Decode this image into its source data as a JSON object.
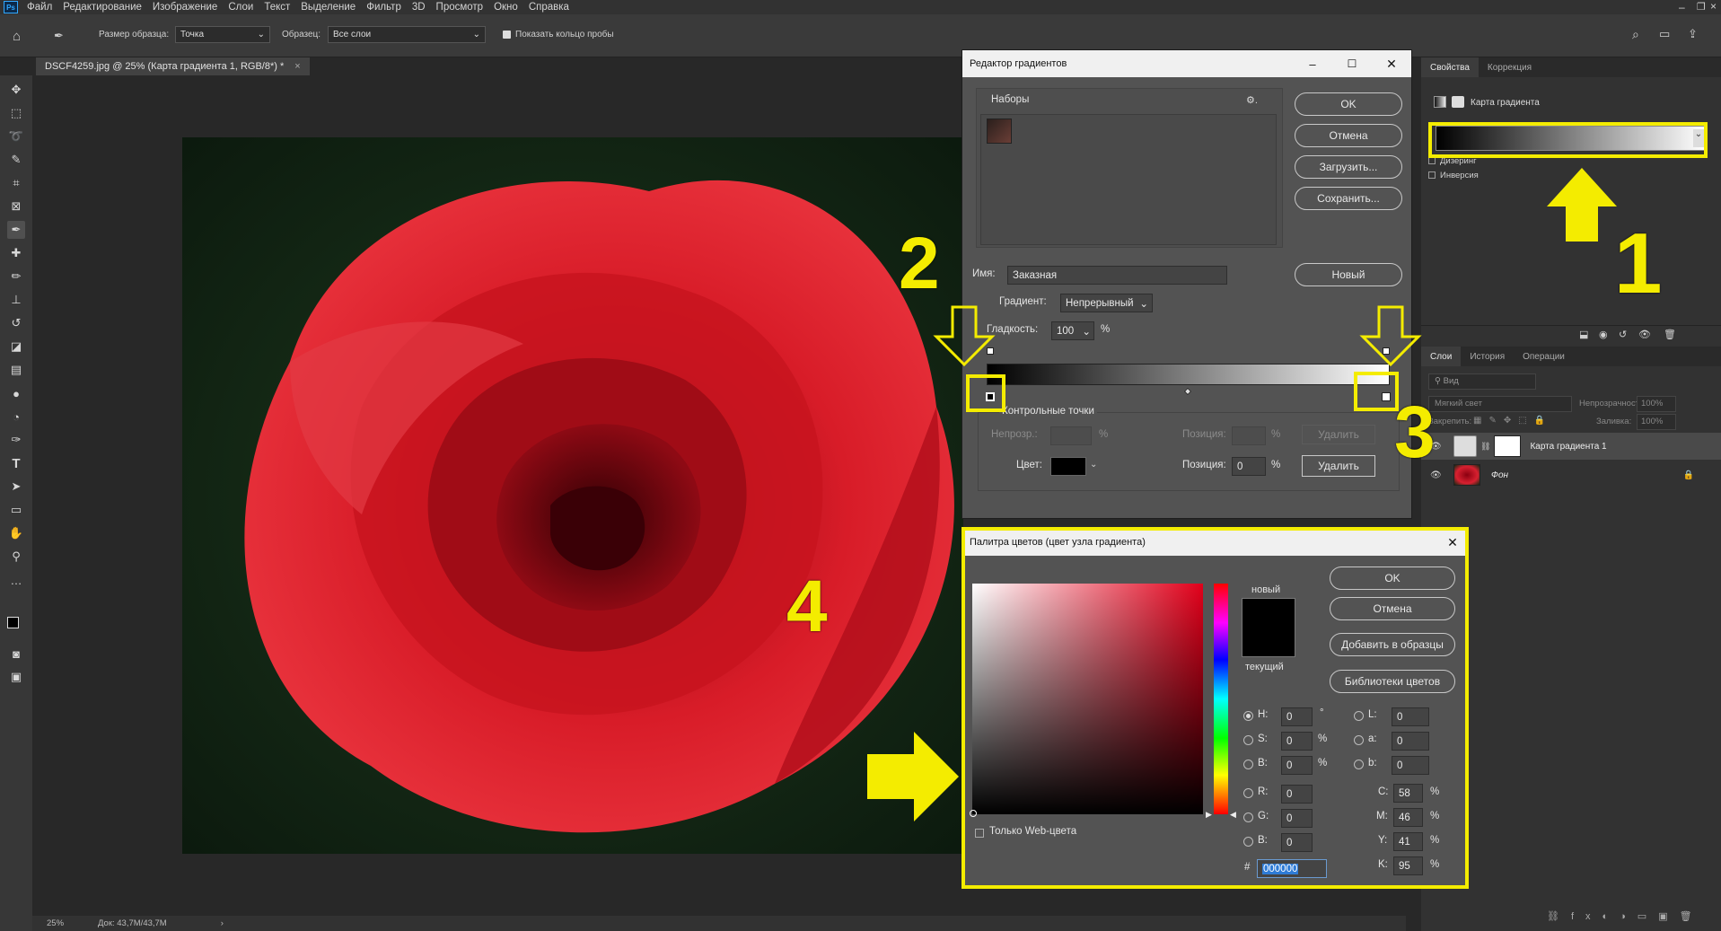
{
  "app": {
    "logo": "Ps"
  },
  "menu": [
    "Файл",
    "Редактирование",
    "Изображение",
    "Слои",
    "Текст",
    "Выделение",
    "Фильтр",
    "3D",
    "Просмотр",
    "Окно",
    "Справка"
  ],
  "options": {
    "sample_size_label": "Размер образца:",
    "sample_size_value": "Точка",
    "sample_label": "Образец:",
    "sample_value": "Все слои",
    "show_ring": "Показать кольцо пробы"
  },
  "doc_tab": {
    "title": "DSCF4259.jpg @ 25% (Карта градиента 1, RGB/8*) *",
    "close": "×"
  },
  "status": {
    "zoom": "25%",
    "doc": "Док: 43,7M/43,7M",
    "arrow": "›"
  },
  "properties": {
    "tab1": "Свойства",
    "tab2": "Коррекция",
    "layer_name": "Карта градиента",
    "dither": "Дизеринг",
    "invert": "Инверсия"
  },
  "layers_panel": {
    "tabs": [
      "Слои",
      "История",
      "Операции"
    ],
    "filter": "Вид",
    "blend": "Мягкий свет",
    "opacity_label": "Непрозрачность:",
    "opacity": "100%",
    "lock_label": "Закрепить:",
    "fill_label": "Заливка:",
    "fill": "100%",
    "layers": [
      {
        "name": "Карта градиента 1"
      },
      {
        "name": "Фон"
      }
    ]
  },
  "gradient_editor": {
    "title": "Редактор градиентов",
    "presets_label": "Наборы",
    "ok": "OK",
    "cancel": "Отмена",
    "load": "Загрузить...",
    "save": "Сохранить...",
    "name_label": "Имя:",
    "name_value": "Заказная",
    "new": "Новый",
    "type_label": "Градиент:",
    "type_value": "Непрерывный",
    "smooth_label": "Гладкость:",
    "smooth_value": "100",
    "percent": "%",
    "stops_label": "Контрольные точки",
    "opacity_label": "Непрозр.:",
    "position_label": "Позиция:",
    "delete": "Удалить",
    "color_label": "Цвет:",
    "color_position": "0"
  },
  "color_picker": {
    "title": "Палитра цветов (цвет узла градиента)",
    "ok": "OK",
    "cancel": "Отмена",
    "add_swatch": "Добавить в образцы",
    "libraries": "Библиотеки цветов",
    "new_label": "новый",
    "current_label": "текущий",
    "web_only": "Только Web-цвета",
    "fields": {
      "H": "0",
      "S": "0",
      "B": "0",
      "R": "0",
      "G": "0",
      "Bb": "0",
      "L": "0",
      "a": "0",
      "b": "0",
      "C": "58",
      "M": "46",
      "Y": "41",
      "K": "95"
    },
    "labels": {
      "H": "H:",
      "S": "S:",
      "B": "B:",
      "R": "R:",
      "G": "G:",
      "Bb": "B:",
      "L": "L:",
      "a": "a:",
      "b": "b:",
      "C": "C:",
      "M": "M:",
      "Y": "Y:",
      "K": "K:"
    },
    "deg": "°",
    "percent": "%",
    "hash": "#",
    "hex": "000000"
  },
  "annotations": {
    "n1": "1",
    "n2": "2",
    "n3": "3",
    "n4": "4"
  },
  "colors": {
    "highlight": "#f4ec00",
    "accent": "#31a8ff",
    "rose": "#c8101c"
  }
}
